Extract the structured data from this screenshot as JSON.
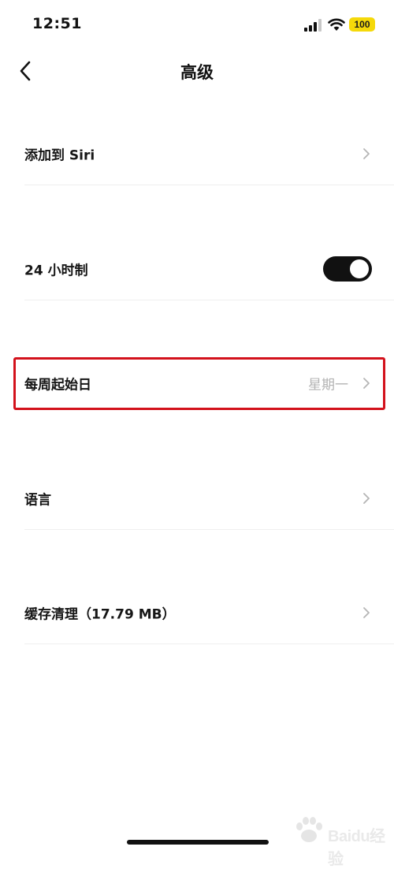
{
  "status_bar": {
    "time": "12:51",
    "battery": "100",
    "battery_color": "#f5d90a",
    "icons": [
      "signal-icon",
      "wifi-icon",
      "battery-icon"
    ]
  },
  "nav": {
    "title": "高级",
    "back_icon": "chevron-left-icon"
  },
  "settings": [
    {
      "label": "添加到 Siri",
      "value": "",
      "type": "link"
    },
    {
      "label": "24 小时制",
      "value": "",
      "type": "toggle",
      "on": true
    },
    {
      "label": "每周起始日",
      "value": "星期一",
      "type": "link",
      "highlighted": true
    },
    {
      "label": "语言",
      "value": "",
      "type": "link"
    },
    {
      "label": "缓存清理（17.79 MB）",
      "value": "",
      "type": "link"
    }
  ],
  "colors": {
    "accent": "#111111",
    "highlight": "#d3121c",
    "value_text": "#b3b3b3"
  },
  "watermark": {
    "text": "Baidu经验"
  }
}
